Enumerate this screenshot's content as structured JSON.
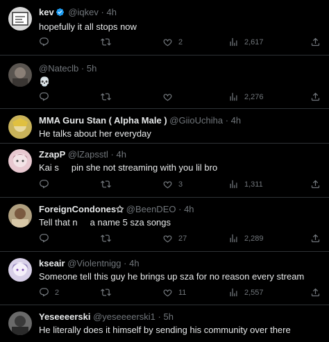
{
  "tweets": [
    {
      "name": "kev",
      "verified": true,
      "handle": "@iqkev",
      "time": "4h",
      "text": "hopefully it all stops now",
      "replies": "",
      "retweets": "",
      "likes": "2",
      "views": "2,617",
      "avatar_color": "#d9d9d9"
    },
    {
      "name": "",
      "verified": false,
      "handle": "@Nateclb",
      "time": "5h",
      "text": "💀",
      "replies": "",
      "retweets": "",
      "likes": "",
      "views": "2,276",
      "avatar_color": "#5a5550"
    },
    {
      "name": "MMA Guru Stan ( Alpha Male )",
      "verified": false,
      "handle": "@GiioUchiha",
      "time": "4h",
      "text": "He talks about her everyday",
      "replies": "",
      "retweets": "",
      "likes": "",
      "views": "",
      "avatar_color": "#c9b35a"
    },
    {
      "name": "ZzapP",
      "verified": false,
      "handle": "@lZapsstl",
      "time": "4h",
      "text_a": "Kai s",
      "text_b": "pin she not streaming with you lil bro",
      "replies": "",
      "retweets": "",
      "likes": "3",
      "views": "1,311",
      "avatar_color": "#e8c8d0"
    },
    {
      "name": "ForeignCondones✩",
      "verified": false,
      "handle": "@BeenDEO",
      "time": "4h",
      "text_a": "Tell that n",
      "text_b": "a name 5 sza songs",
      "replies": "",
      "retweets": "",
      "likes": "27",
      "views": "2,289",
      "avatar_color": "#b0a080"
    },
    {
      "name": "kseair",
      "verified": false,
      "handle": "@Violentnigg",
      "time": "4h",
      "text": "Someone tell this guy he brings up sza for no reason every stream",
      "replies": "2",
      "retweets": "",
      "likes": "11",
      "views": "2,557",
      "avatar_color": "#d8d0e8"
    },
    {
      "name": "Yeseeeerski",
      "verified": false,
      "handle": "@yeseeeerski1",
      "time": "5h",
      "text": "He literally does it himself by sending his community over there",
      "avatar_color": "#6a6a6a"
    }
  ],
  "dot": "·",
  "icons": {
    "reply": "reply-icon",
    "retweet": "retweet-icon",
    "like": "heart-icon",
    "views": "views-icon",
    "share": "share-icon",
    "verified": "verified-badge-icon"
  },
  "colors": {
    "background": "#000000",
    "text": "#e7e9ea",
    "muted": "#71767b",
    "divider": "#2f3336",
    "verified": "#1d9bf0"
  }
}
